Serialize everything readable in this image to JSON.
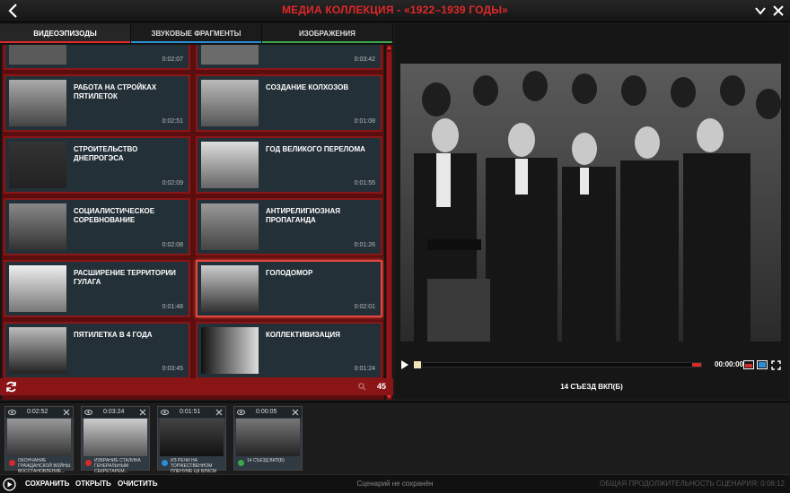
{
  "window": {
    "title": "МЕДИА КОЛЛЕКЦИЯ - «1922–1939 ГОДЫ»"
  },
  "tabs": [
    {
      "label": "ВИДЕОЭПИЗОДЫ",
      "accent": "#e0282a"
    },
    {
      "label": "ЗВУКОВЫЕ ФРАГМЕНТЫ",
      "accent": "#2a8fd6"
    },
    {
      "label": "ИЗОБРАЖЕНИЯ",
      "accent": "#3aa84a"
    }
  ],
  "episodes": [
    {
      "title": "",
      "duration": "0:02:07"
    },
    {
      "title": "",
      "duration": "0:03:42"
    },
    {
      "title": "РАБОТА НА СТРОЙКАХ ПЯТИЛЕТОК",
      "duration": "0:02:51"
    },
    {
      "title": "СОЗДАНИЕ КОЛХОЗОВ",
      "duration": "0:01:08"
    },
    {
      "title": "СТРОИТЕЛЬСТВО ДНЕПРОГЭСА",
      "duration": "0:02:09"
    },
    {
      "title": "ГОД ВЕЛИКОГО ПЕРЕЛОМА",
      "duration": "0:01:55"
    },
    {
      "title": "СОЦИАЛИСТИЧЕСКОЕ СОРЕВНОВАНИЕ",
      "duration": "0:02:08"
    },
    {
      "title": "АНТИРЕЛИГИОЗНАЯ ПРОПАГАНДА",
      "duration": "0:01:26"
    },
    {
      "title": "РАСШИРЕНИЕ ТЕРРИТОРИИ ГУЛАГА",
      "duration": "0:01:48"
    },
    {
      "title": "ГОЛОДОМОР",
      "duration": "0:02:01"
    },
    {
      "title": "ПЯТИЛЕТКА В 4 ГОДА",
      "duration": "0:03:45"
    },
    {
      "title": "КОЛЛЕКТИВИЗАЦИЯ",
      "duration": "0:01:24"
    }
  ],
  "selected_index": 9,
  "search": {
    "count": "45"
  },
  "player": {
    "timecode": "00:00:00",
    "caption": "14 СЪЕЗД ВКП(Б)",
    "progress": 0.0
  },
  "clips": [
    {
      "time": "0:02:52",
      "label": "ОКОНЧАНИЕ ГРАЖДАНСКОЙ ВОЙНЫ. ВОССТАНОВЛЕНИЕ...",
      "dot": "#d62a2a"
    },
    {
      "time": "0:03:24",
      "label": "ИЗБРАНИЕ СТАЛИНА ГЕНЕРАЛЬНЫМ СЕКРЕТАРЕМ...",
      "dot": "#d62a2a"
    },
    {
      "time": "0:01:51",
      "label": "ИЗ РЕЧИ НА ТОРЖЕСТВЕННОМ ПЛЕНУМЕ ЦК ВЛКСМ",
      "dot": "#2a8fd6"
    },
    {
      "time": "0:00:05",
      "label": "14 СЪЕЗД ВКП(Б)",
      "dot": "#3aa84a"
    }
  ],
  "bottom": {
    "save": "СОХРАНИТЬ",
    "open": "ОТКРЫТЬ",
    "clear": "ОЧИСТИТЬ",
    "status": "Сценарий не сохранён",
    "total": "ОБЩАЯ ПРОДОЛЖИТЕЛЬНОСТЬ СЦЕНАРИЯ: 0:08:12"
  }
}
